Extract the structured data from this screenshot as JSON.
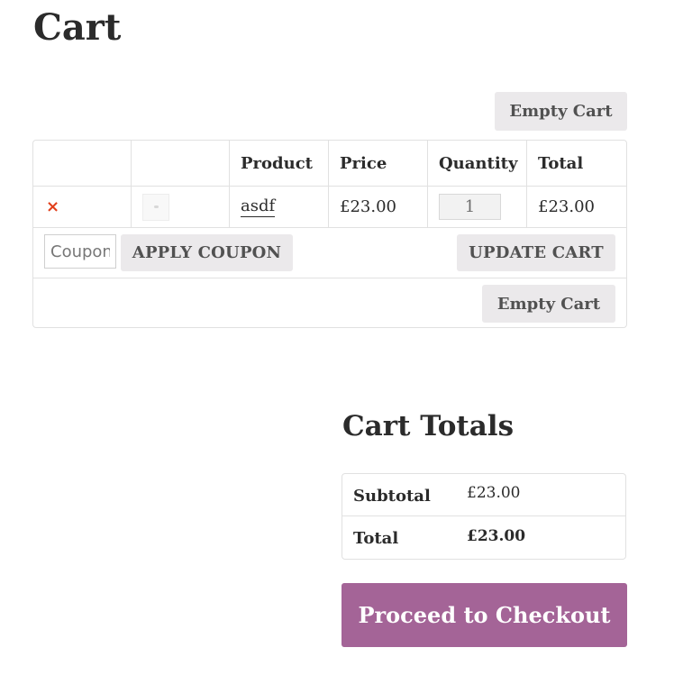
{
  "page": {
    "title": "Cart"
  },
  "cart": {
    "empty_cart_top_label": "Empty Cart",
    "columns": {
      "remove": "",
      "thumbnail": "",
      "product": "Product",
      "price": "Price",
      "quantity": "Quantity",
      "total": "Total"
    },
    "items": [
      {
        "remove_icon": "×",
        "product": "asdf",
        "price": "£23.00",
        "quantity": "1",
        "total": "£23.00"
      }
    ],
    "coupon": {
      "placeholder": "Coupon code",
      "apply_label": "APPLY COUPON"
    },
    "update_label": "UPDATE CART",
    "empty_cart_bottom_label": "Empty Cart"
  },
  "totals": {
    "title": "Cart Totals",
    "subtotal_label": "Subtotal",
    "subtotal_value": "£23.00",
    "total_label": "Total",
    "total_value": "£23.00"
  },
  "checkout": {
    "label": "Proceed to Checkout"
  },
  "colors": {
    "accent": "#a46497",
    "remove": "#e2401c",
    "button_bg": "#ebe9eb",
    "border": "#e1e1e1"
  },
  "icons": {
    "remove": "remove-item-icon",
    "thumbnail": "product-thumbnail-placeholder"
  }
}
